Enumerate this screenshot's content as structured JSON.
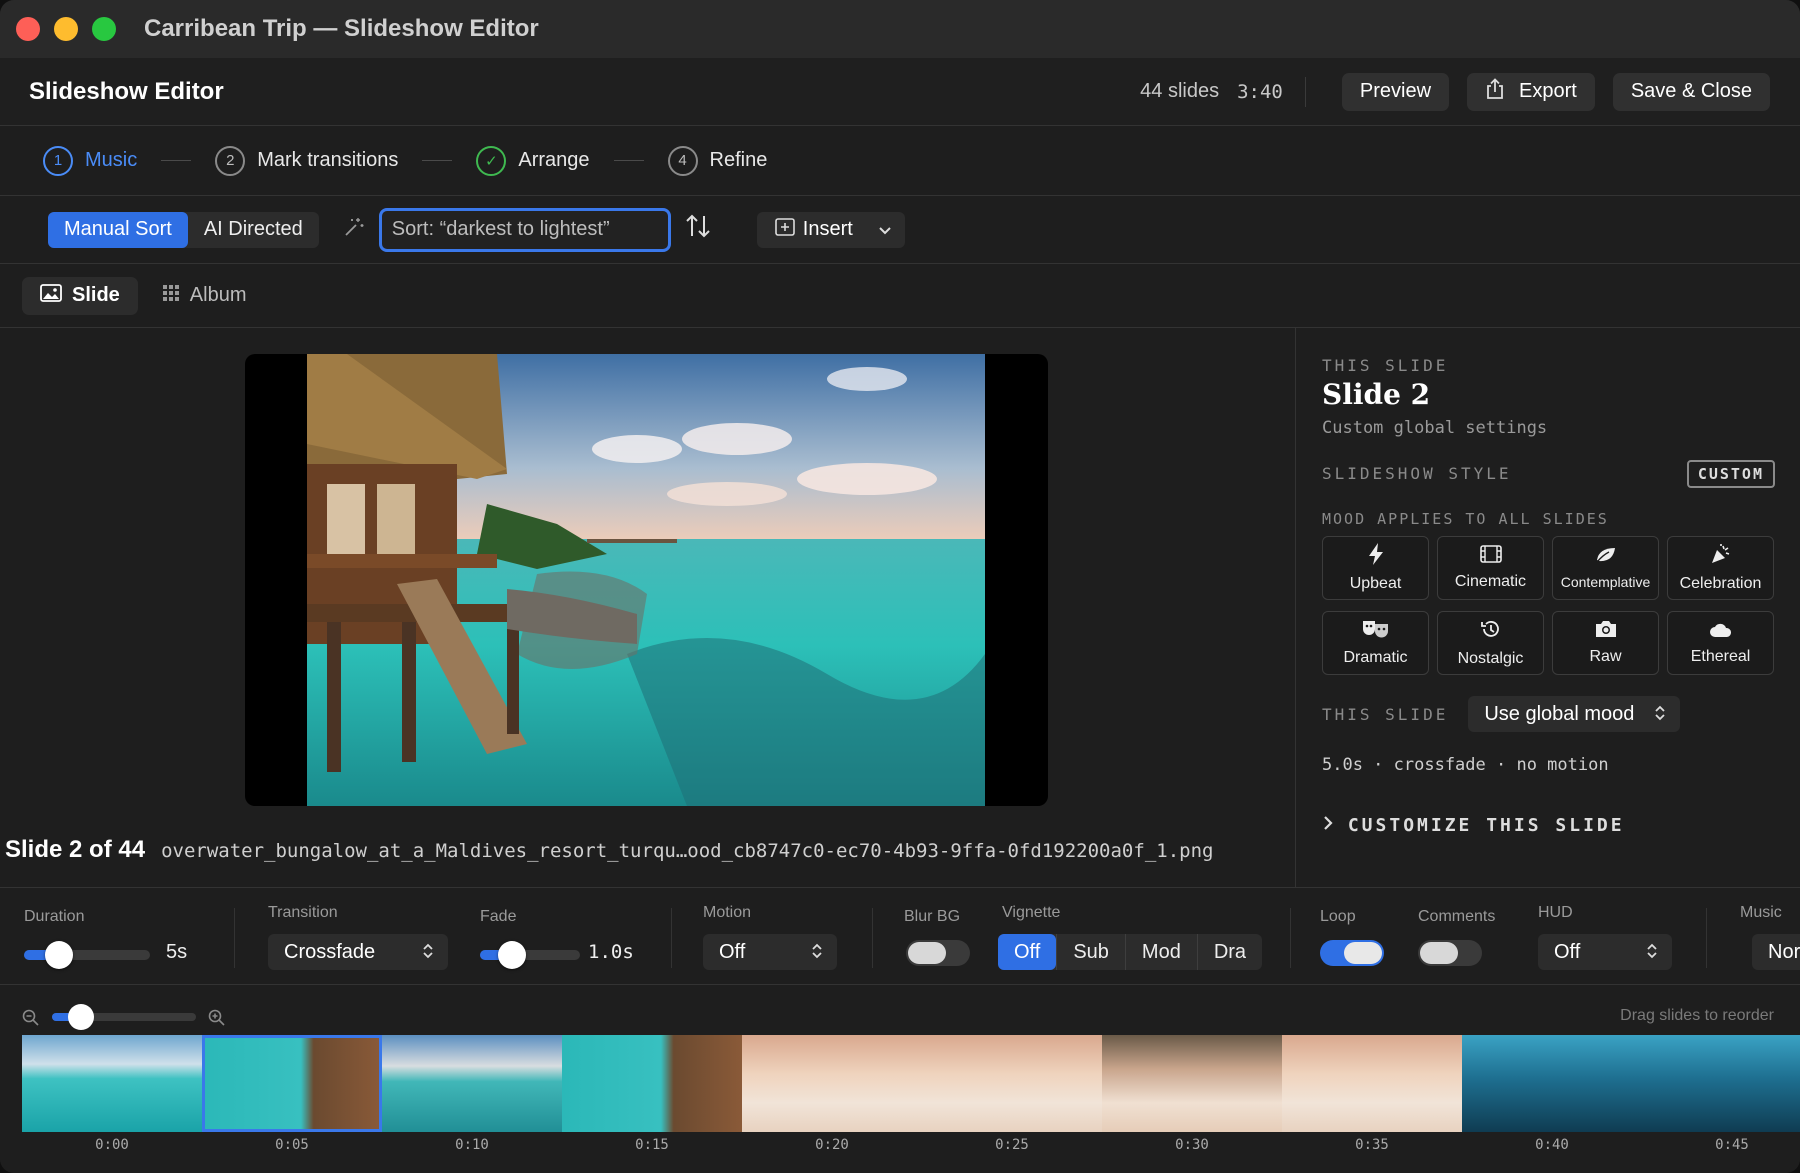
{
  "window": {
    "title": "Carribean Trip — Slideshow Editor"
  },
  "header": {
    "title": "Slideshow Editor",
    "slide_count": "44 slides",
    "duration": "3:40",
    "preview_label": "Preview",
    "export_label": "Export",
    "save_label": "Save & Close"
  },
  "steps": [
    {
      "num": "1",
      "label": "Music",
      "state": "active"
    },
    {
      "num": "2",
      "label": "Mark transitions",
      "state": "pending"
    },
    {
      "num": "✓",
      "label": "Arrange",
      "state": "done"
    },
    {
      "num": "4",
      "label": "Refine",
      "state": "pending"
    }
  ],
  "toolbar": {
    "manual_sort": "Manual Sort",
    "ai_directed": "AI Directed",
    "sort_value": "Sort: “darkest to lightest”",
    "insert_label": "Insert"
  },
  "view_tabs": {
    "slide": "Slide",
    "album": "Album"
  },
  "preview": {
    "slide_label": "Slide 2 of 44",
    "filename": "overwater_bungalow_at_a_Maldives_resort_turqu…ood_cb8747c0-ec70-4b93-9ffa-0fd192200a0f_1.png"
  },
  "panel": {
    "this_slide_label": "THIS SLIDE",
    "slide_title": "Slide 2",
    "slide_sub": "Custom global settings",
    "style_label": "SLIDESHOW STYLE",
    "style_badge": "CUSTOM",
    "mood_label": "MOOD APPLIES TO ALL SLIDES",
    "moods": [
      {
        "label": "Upbeat",
        "icon": "lightning-icon",
        "glyph": "⚡"
      },
      {
        "label": "Cinematic",
        "icon": "film-icon",
        "glyph": "🎞"
      },
      {
        "label": "Contemplative",
        "icon": "leaf-icon",
        "glyph": "🍃"
      },
      {
        "label": "Celebration",
        "icon": "party-popper-icon",
        "glyph": "🎉"
      },
      {
        "label": "Dramatic",
        "icon": "theater-masks-icon",
        "glyph": "🎭"
      },
      {
        "label": "Nostalgic",
        "icon": "history-clock-icon",
        "glyph": "↺"
      },
      {
        "label": "Raw",
        "icon": "camera-icon",
        "glyph": "📷"
      },
      {
        "label": "Ethereal",
        "icon": "cloud-icon",
        "glyph": "☁"
      }
    ],
    "this_slide_mood_label": "THIS SLIDE",
    "mood_select": "Use global mood",
    "summary": "5.0s · crossfade · no motion",
    "customize_label": "CUSTOMIZE THIS SLIDE"
  },
  "controls": {
    "duration": {
      "label": "Duration",
      "value": "5s",
      "level": 0.18
    },
    "transition": {
      "label": "Transition",
      "value": "Crossfade"
    },
    "fade": {
      "label": "Fade",
      "value": "1.0s",
      "level": 0.2
    },
    "motion": {
      "label": "Motion",
      "value": "Off"
    },
    "blur_bg": {
      "label": "Blur BG",
      "on": false
    },
    "vignette": {
      "label": "Vignette",
      "options": [
        "Off",
        "Sub",
        "Mod",
        "Dra"
      ],
      "selected": "Off"
    },
    "loop": {
      "label": "Loop",
      "on": true
    },
    "comments": {
      "label": "Comments",
      "on": false
    },
    "hud": {
      "label": "HUD",
      "value": "Off"
    },
    "music": {
      "label": "Music",
      "value": "Nor"
    }
  },
  "filmstrip": {
    "hint": "Drag slides to reorder",
    "zoom_level": 0.15,
    "thumbs": [
      {
        "time": "0:00",
        "scene": "reef"
      },
      {
        "time": "0:05",
        "scene": "bung",
        "selected": true
      },
      {
        "time": "0:10",
        "scene": "dock"
      },
      {
        "time": "0:15",
        "scene": "bung"
      },
      {
        "time": "0:20",
        "scene": "beach"
      },
      {
        "time": "0:25",
        "scene": "beach"
      },
      {
        "time": "0:30",
        "scene": "palm"
      },
      {
        "time": "0:35",
        "scene": "beach"
      },
      {
        "time": "0:40",
        "scene": "under"
      },
      {
        "time": "0:45",
        "scene": "under"
      }
    ]
  },
  "colors": {
    "accent": "#2f6fe4",
    "done": "#3fb950",
    "background": "#1e1e1e"
  }
}
